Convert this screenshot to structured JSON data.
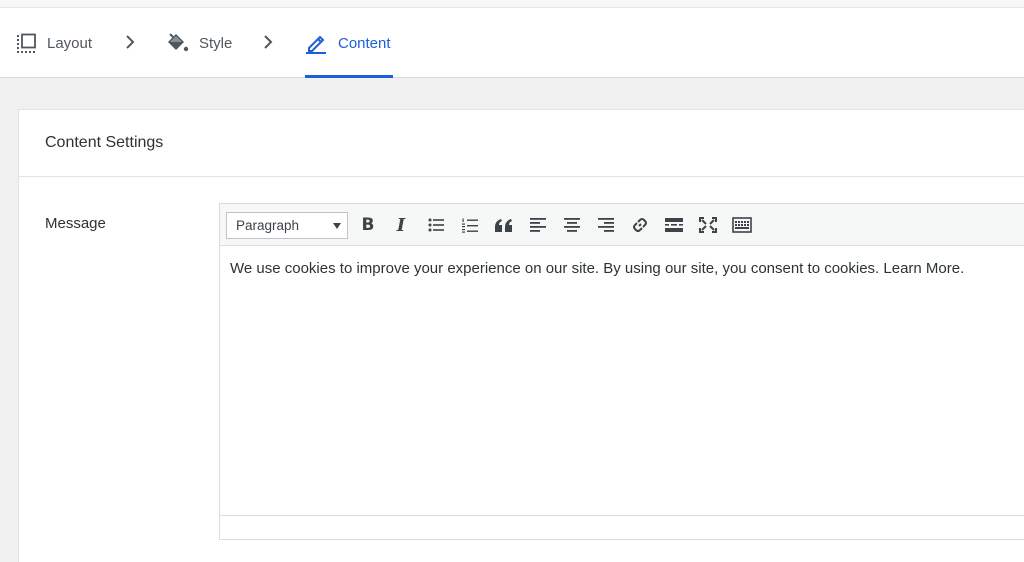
{
  "steps": [
    {
      "label": "Layout",
      "icon": "layout-icon",
      "active": false
    },
    {
      "label": "Style",
      "icon": "paint-bucket-icon",
      "active": false
    },
    {
      "label": "Content",
      "icon": "pencil-icon",
      "active": true
    }
  ],
  "colors": {
    "accent": "#1e5ed8",
    "text": "#2c3338",
    "muted": "#50575e"
  },
  "panel": {
    "title": "Content Settings"
  },
  "field": {
    "label": "Message"
  },
  "editor": {
    "format_select": "Paragraph",
    "toolbar_icons": [
      "bold-icon",
      "italic-icon",
      "bullet-list-icon",
      "numbered-list-icon",
      "blockquote-icon",
      "align-left-icon",
      "align-center-icon",
      "align-right-icon",
      "link-icon",
      "read-more-icon",
      "fullscreen-icon",
      "toolbar-toggle-icon"
    ],
    "bold_glyph": "B",
    "italic_glyph": "I",
    "content": "We use cookies to improve your experience on our site. By using our site, you consent to cookies. Learn More."
  }
}
